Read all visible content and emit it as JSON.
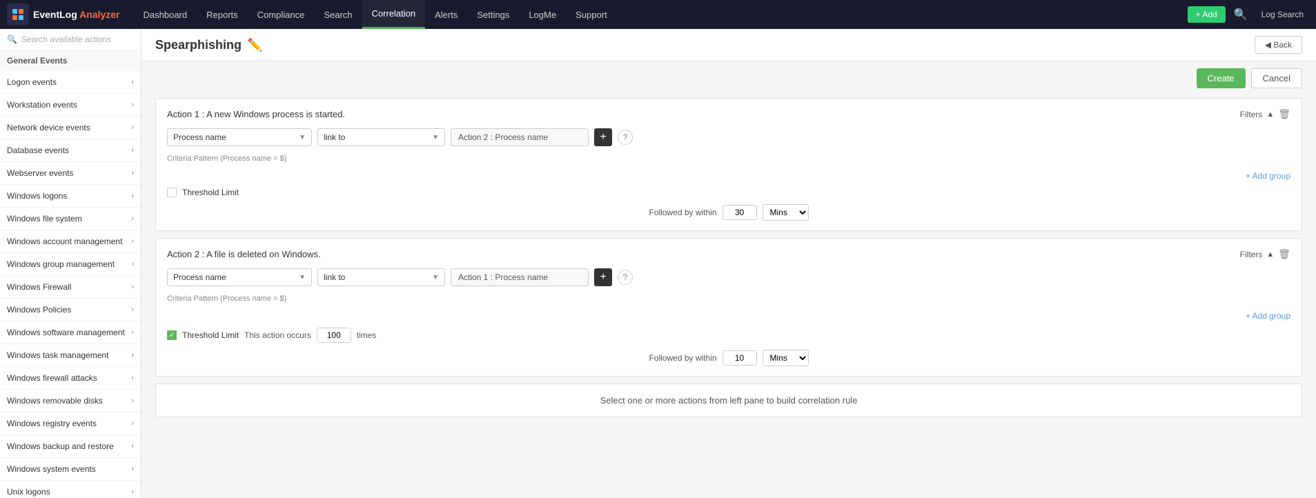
{
  "brand": {
    "logo_text": "EventLog",
    "logo_accent": " Analyzer",
    "logo_emoji": "📊"
  },
  "navbar": {
    "tabs": [
      {
        "id": "dashboard",
        "label": "Dashboard",
        "active": false
      },
      {
        "id": "reports",
        "label": "Reports",
        "active": false
      },
      {
        "id": "compliance",
        "label": "Compliance",
        "active": false
      },
      {
        "id": "search",
        "label": "Search",
        "active": false
      },
      {
        "id": "correlation",
        "label": "Correlation",
        "active": true
      },
      {
        "id": "alerts",
        "label": "Alerts",
        "active": false
      },
      {
        "id": "settings",
        "label": "Settings",
        "active": false
      },
      {
        "id": "logme",
        "label": "LogMe",
        "active": false
      },
      {
        "id": "support",
        "label": "Support",
        "active": false
      }
    ],
    "add_label": "+ Add",
    "log_search_label": "Log Search",
    "back_label": "◀ Back"
  },
  "sidebar": {
    "search_placeholder": "Search available actions",
    "section_header": "General Events",
    "items": [
      {
        "id": "logon",
        "label": "Logon events"
      },
      {
        "id": "workstation",
        "label": "Workstation events"
      },
      {
        "id": "network",
        "label": "Network device events"
      },
      {
        "id": "database",
        "label": "Database events"
      },
      {
        "id": "webserver",
        "label": "Webserver events"
      },
      {
        "id": "win-logons",
        "label": "Windows logons"
      },
      {
        "id": "win-filesystem",
        "label": "Windows file system"
      },
      {
        "id": "win-account",
        "label": "Windows account management"
      },
      {
        "id": "win-group",
        "label": "Windows group management"
      },
      {
        "id": "win-firewall",
        "label": "Windows Firewall"
      },
      {
        "id": "win-policies",
        "label": "Windows Policies"
      },
      {
        "id": "win-software",
        "label": "Windows software management"
      },
      {
        "id": "win-task",
        "label": "Windows task management"
      },
      {
        "id": "win-firewall-attacks",
        "label": "Windows firewall attacks"
      },
      {
        "id": "win-removable",
        "label": "Windows removable disks"
      },
      {
        "id": "win-registry",
        "label": "Windows registry events"
      },
      {
        "id": "win-backup",
        "label": "Windows backup and restore"
      },
      {
        "id": "win-system",
        "label": "Windows system events"
      },
      {
        "id": "unix-logons",
        "label": "Unix logons"
      }
    ]
  },
  "page": {
    "title": "Spearphishing",
    "create_label": "Create",
    "cancel_label": "Cancel",
    "back_label": "Back"
  },
  "action1": {
    "header": "Action 1 : A new Windows process is started.",
    "filters_label": "Filters",
    "field1_value": "Process name",
    "field2_value": "link to",
    "field3_value": "Action 2 : Process name",
    "criteria_pattern": "Criteria Pattern (Process name = $)",
    "add_group_label": "+ Add group",
    "threshold_label": "Threshold Limit",
    "threshold_checked": false,
    "followed_by_label": "Followed by within",
    "followed_value": "30",
    "mins_value": "Mins"
  },
  "action2": {
    "header": "Action 2 : A file is deleted on Windows.",
    "filters_label": "Filters",
    "field1_value": "Process name",
    "field2_value": "link to",
    "field3_value": "Action 1 : Process name",
    "criteria_pattern": "Criteria Pattern (Process name = $)",
    "add_group_label": "+ Add group",
    "threshold_label": "Threshold Limit",
    "threshold_checked": true,
    "threshold_text": "This action occurs",
    "threshold_count": "100",
    "threshold_times": "times",
    "followed_by_label": "Followed by within",
    "followed_value": "10",
    "mins_value": "Mins"
  },
  "bottom_info": {
    "text": "Select one or more actions from left pane to build correlation rule"
  }
}
